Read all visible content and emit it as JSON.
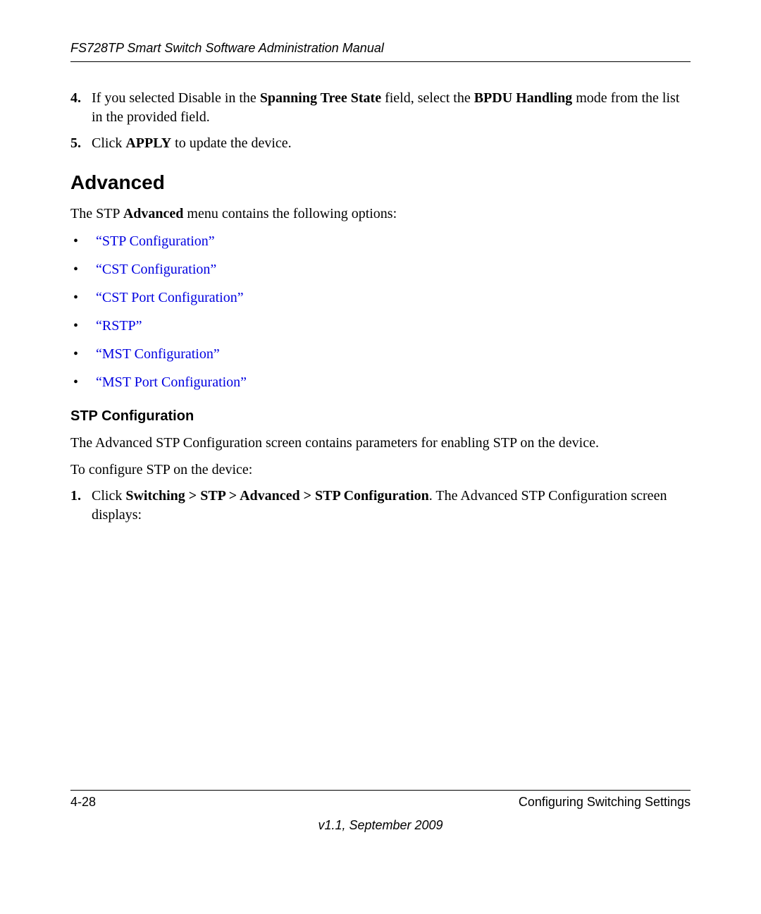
{
  "header": "FS728TP Smart Switch Software Administration Manual",
  "step4": {
    "num": "4.",
    "pre": "If you selected Disable in the ",
    "b1": "Spanning Tree State",
    "mid": " field, select the ",
    "b2": "BPDU Handling",
    "post": " mode from the list in the provided field."
  },
  "step5": {
    "num": "5.",
    "pre": "Click ",
    "b1": "APPLY",
    "post": " to update the device."
  },
  "section_title": "Advanced",
  "intro": {
    "pre": "The STP ",
    "b1": "Advanced",
    "post": " menu contains the following options:"
  },
  "links": [
    "“STP Configuration”",
    "“CST Configuration”",
    "“CST Port Configuration”",
    "“RSTP”",
    "“MST Configuration”",
    "“MST Port Configuration”"
  ],
  "subsection": "STP Configuration",
  "sub_p1": "The Advanced STP Configuration screen contains parameters for enabling STP on the device.",
  "sub_p2": "To configure STP on the device:",
  "sub_step1": {
    "num": "1.",
    "pre": "Click ",
    "b1": "Switching > STP > Advanced > STP Configuration",
    "post": ". The Advanced STP Configuration screen displays:"
  },
  "footer": {
    "page": "4-28",
    "chapter": "Configuring Switching Settings",
    "version": "v1.1, September 2009"
  }
}
